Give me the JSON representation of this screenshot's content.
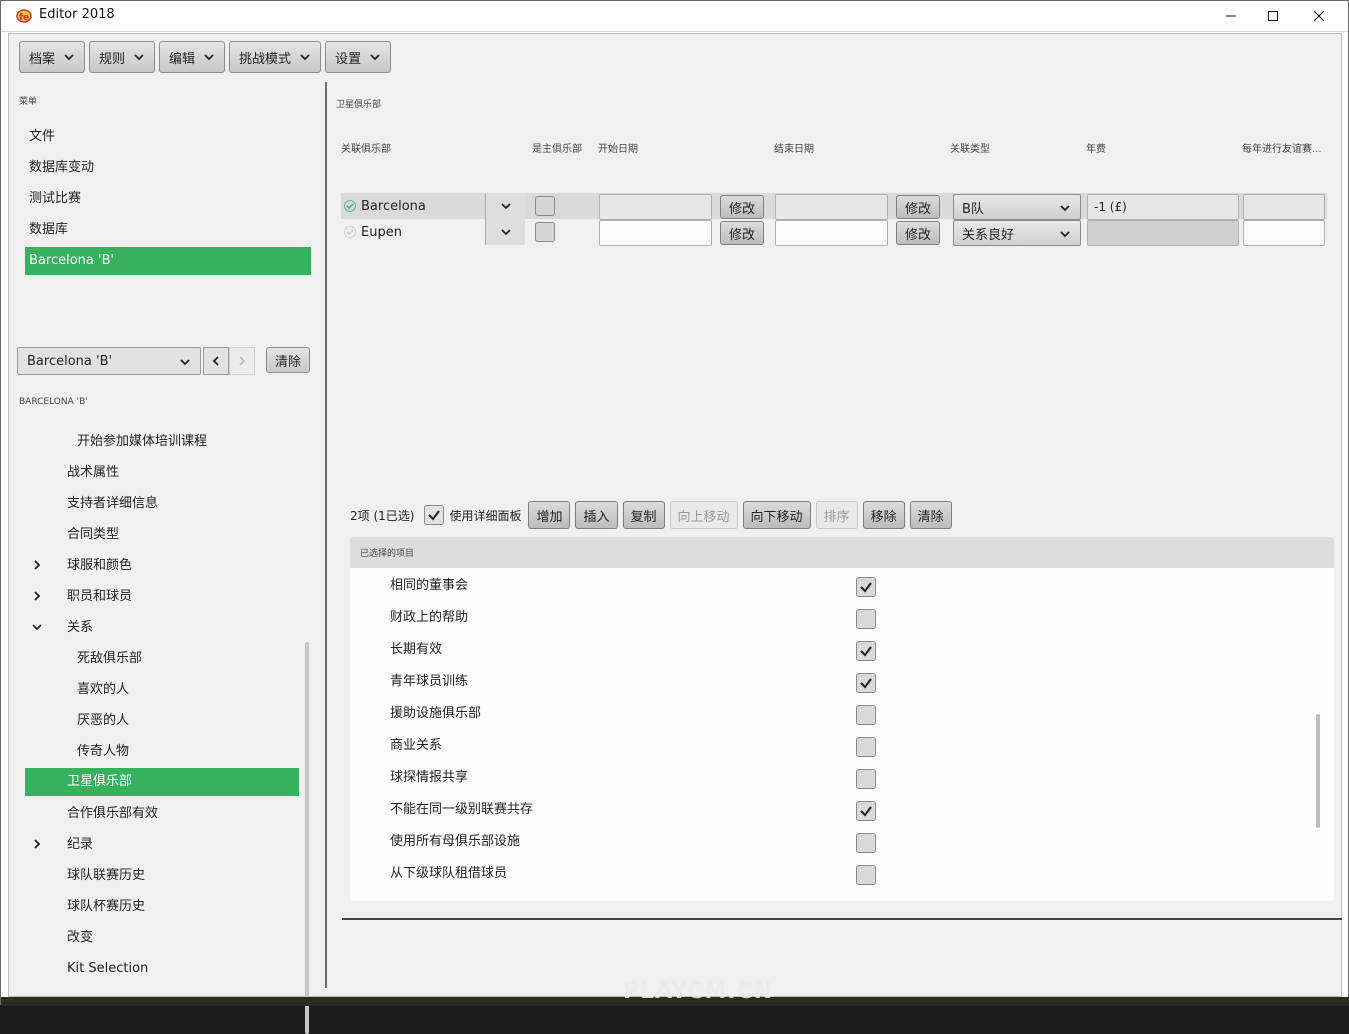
{
  "window": {
    "title": "Editor 2018"
  },
  "menubar": [
    "档案",
    "规则",
    "编辑",
    "挑战模式",
    "设置"
  ],
  "sidebar": {
    "menu_label": "菜单",
    "menu_items": [
      "文件",
      "数据库变动",
      "测试比赛",
      "数据库",
      "Barcelona 'B'"
    ],
    "active_menu_index": 4,
    "club_select": "Barcelona 'B'",
    "clear_label": "清除",
    "section_label": "BARCELONA 'B'"
  },
  "tree": [
    {
      "label": "开始参加媒体培训课程",
      "level": 2,
      "toggle": ""
    },
    {
      "label": "战术属性",
      "level": 1,
      "toggle": ""
    },
    {
      "label": "支持者详细信息",
      "level": 1,
      "toggle": ""
    },
    {
      "label": "合同类型",
      "level": 1,
      "toggle": ""
    },
    {
      "label": "球服和颜色",
      "level": 1,
      "toggle": "collapsed"
    },
    {
      "label": "职员和球员",
      "level": 1,
      "toggle": "collapsed"
    },
    {
      "label": "关系",
      "level": 1,
      "toggle": "expanded"
    },
    {
      "label": "死敌俱乐部",
      "level": 2,
      "toggle": ""
    },
    {
      "label": "喜欢的人",
      "level": 2,
      "toggle": ""
    },
    {
      "label": "厌恶的人",
      "level": 2,
      "toggle": ""
    },
    {
      "label": "传奇人物",
      "level": 2,
      "toggle": ""
    },
    {
      "label": "卫星俱乐部",
      "level": 1,
      "toggle": "",
      "active": true
    },
    {
      "label": "合作俱乐部有效",
      "level": 1,
      "toggle": ""
    },
    {
      "label": "纪录",
      "level": 1,
      "toggle": "collapsed"
    },
    {
      "label": "球队联赛历史",
      "level": 1,
      "toggle": ""
    },
    {
      "label": "球队杯赛历史",
      "level": 1,
      "toggle": ""
    },
    {
      "label": "改变",
      "level": 1,
      "toggle": ""
    },
    {
      "label": "Kit Selection",
      "level": 1,
      "toggle": ""
    }
  ],
  "main": {
    "section_title": "卫星俱乐部",
    "columns": [
      "关联俱乐部",
      "是主俱乐部",
      "开始日期",
      "结束日期",
      "关联类型",
      "年费",
      "每年进行友谊赛..."
    ],
    "edit_label": "修改",
    "rows": [
      {
        "club": "Barcelona",
        "is_parent": false,
        "start": "",
        "end": "",
        "type": "B队",
        "fee": "-1 (£)",
        "friendlies": "",
        "selected": true
      },
      {
        "club": "Eupen",
        "is_parent": false,
        "start": "",
        "end": "",
        "type": "关系良好",
        "fee": "",
        "friendlies": "",
        "selected": false
      }
    ],
    "toolbar": {
      "count": "2项 (1已选)",
      "detail_checked": true,
      "detail_label": "使用详细面板",
      "buttons": [
        {
          "label": "增加",
          "enabled": true
        },
        {
          "label": "插入",
          "enabled": true
        },
        {
          "label": "复制",
          "enabled": true
        },
        {
          "label": "向上移动",
          "enabled": false
        },
        {
          "label": "向下移动",
          "enabled": true
        },
        {
          "label": "排序",
          "enabled": false
        },
        {
          "label": "移除",
          "enabled": true
        },
        {
          "label": "清除",
          "enabled": true
        }
      ]
    },
    "selected_panel": {
      "title": "已选择的项目",
      "options": [
        {
          "label": "相同的董事会",
          "checked": true
        },
        {
          "label": "财政上的帮助",
          "checked": false
        },
        {
          "label": "长期有效",
          "checked": true
        },
        {
          "label": "青年球员训练",
          "checked": true
        },
        {
          "label": "援助设施俱乐部",
          "checked": false
        },
        {
          "label": "商业关系",
          "checked": false
        },
        {
          "label": "球探情报共享",
          "checked": false
        },
        {
          "label": "不能在同一级别联赛共存",
          "checked": true
        },
        {
          "label": "使用所有母俱乐部设施",
          "checked": false
        },
        {
          "label": "从下级球队租借球员",
          "checked": false
        }
      ]
    }
  },
  "watermark": "PLAYCM.CN",
  "colors": {
    "accent": "#36b25f"
  }
}
